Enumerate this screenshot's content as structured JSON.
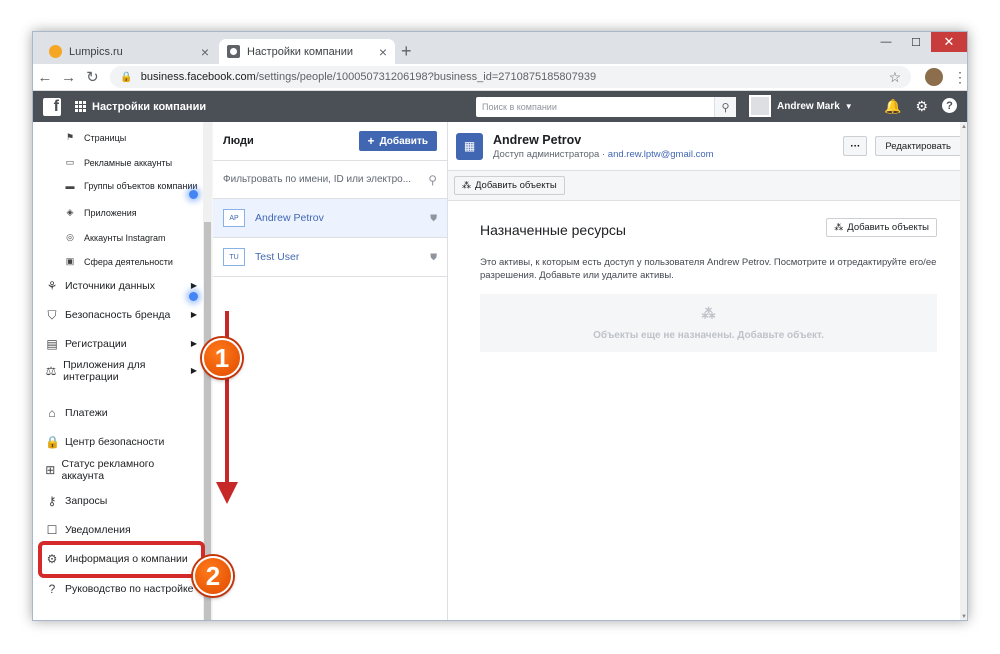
{
  "browser": {
    "tabs": [
      {
        "title": "Lumpics.ru",
        "active": false
      },
      {
        "title": "Настройки компании",
        "active": true
      }
    ],
    "url_host": "business.facebook.com",
    "url_path": "/settings/people/100050731206198?business_id=2710875185807939"
  },
  "fb": {
    "title": "Настройки компании",
    "search_placeholder": "Поиск в компании",
    "user_name": "Andrew Mark"
  },
  "sidebar": {
    "sub_items": [
      {
        "icon": "flag-icon",
        "label": "Страницы"
      },
      {
        "icon": "ad-account-icon",
        "label": "Рекламные аккаунты"
      },
      {
        "icon": "folder-icon",
        "label": "Группы объектов компании"
      },
      {
        "icon": "cube-icon",
        "label": "Приложения"
      },
      {
        "icon": "instagram-icon",
        "label": "Аккаунты Instagram"
      },
      {
        "icon": "briefcase-icon",
        "label": "Сфера деятельности"
      }
    ],
    "items": [
      {
        "icon": "data-sources-icon",
        "label": "Источники данных",
        "arrow": true
      },
      {
        "icon": "shield-icon",
        "label": "Безопасность бренда",
        "arrow": true
      },
      {
        "icon": "clipboard-icon",
        "label": "Регистрации",
        "arrow": true
      },
      {
        "icon": "integrations-icon",
        "label": "Приложения для интеграции",
        "arrow": true
      },
      {
        "icon": "bank-icon",
        "label": "Платежи",
        "arrow": false
      },
      {
        "icon": "lock-icon",
        "label": "Центр безопасности",
        "arrow": false
      },
      {
        "icon": "ad-status-icon",
        "label": "Статус рекламного аккаунта",
        "arrow": false
      },
      {
        "icon": "key-icon",
        "label": "Запросы",
        "arrow": false
      },
      {
        "icon": "notification-icon",
        "label": "Уведомления",
        "arrow": false
      },
      {
        "icon": "gear-icon",
        "label": "Информация о компании",
        "arrow": false
      },
      {
        "icon": "help-icon",
        "label": "Руководство по настройке",
        "arrow": false
      }
    ]
  },
  "people": {
    "title": "Люди",
    "add_label": "Добавить",
    "filter_placeholder": "Фильтровать по имени, ID или электро...",
    "rows": [
      {
        "initials": "AP",
        "name": "Andrew Petrov",
        "selected": true
      },
      {
        "initials": "TU",
        "name": "Test User",
        "selected": false
      }
    ]
  },
  "detail": {
    "name": "Andrew Petrov",
    "role": "Доступ администратора",
    "email": "and.rew.lptw@gmail.com",
    "more_label": "···",
    "edit_label": "Редактировать",
    "add_assets_label": "Добавить объекты",
    "section_title": "Назначенные ресурсы",
    "section_desc": "Это активы, к которым есть доступ у пользователя Andrew Petrov. Посмотрите и отредактируйте его/ее разрешения. Добавьте или удалите активы.",
    "empty_text": "Объекты еще не назначены. Добавьте объект."
  },
  "annotations": {
    "step1": "1",
    "step2": "2"
  },
  "colors": {
    "fb_blue": "#4267b2",
    "fb_bar": "#4b4f56",
    "annotation_red": "#c62828",
    "annotation_orange": "#e04a00"
  }
}
